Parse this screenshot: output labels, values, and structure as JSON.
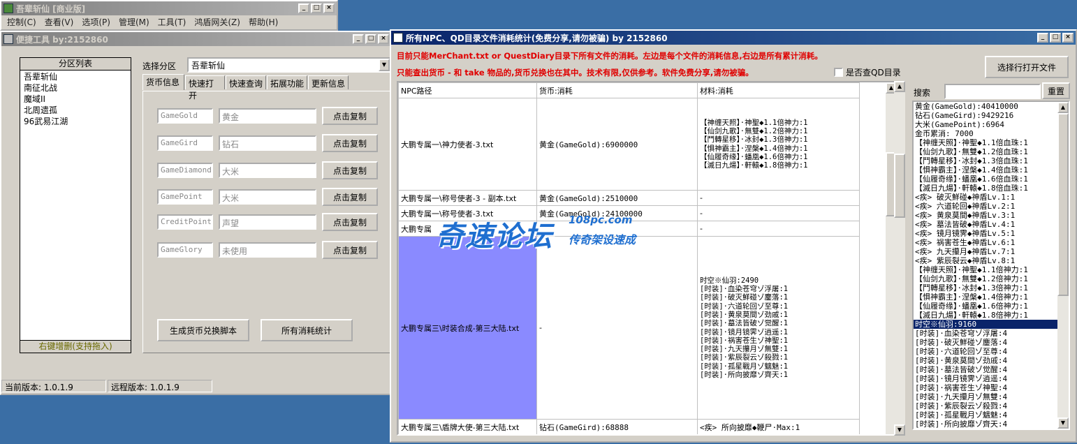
{
  "main_window": {
    "title": "吾辈斩仙 [商业版]",
    "menus": [
      "控制(C)",
      "查看(V)",
      "选项(P)",
      "管理(M)",
      "工具(T)",
      "鸿盾网关(Z)",
      "帮助(H)"
    ]
  },
  "tool_window": {
    "title": "便捷工具   by:2152860",
    "zone_list_title": "分区列表",
    "zones": [
      "吾辈斩仙",
      "南征北战",
      "魔域II",
      "北周遗孤",
      "96武易江湖"
    ],
    "zone_hint": "右键增删(支持拖入)",
    "select_label": "选择分区",
    "select_value": "吾辈斩仙",
    "tabs": [
      "货币信息",
      "快速打开",
      "快速查询",
      "拓展功能",
      "更新信息"
    ],
    "currency_rows": [
      {
        "key": "GameGold",
        "name": "黄金",
        "button": "点击复制"
      },
      {
        "key": "GameGird",
        "name": "钻石",
        "button": "点击复制"
      },
      {
        "key": "GameDiamond",
        "name": "大米",
        "button": "点击复制"
      },
      {
        "key": "GamePoint",
        "name": "大米",
        "button": "点击复制"
      },
      {
        "key": "CreditPoint",
        "name": "声望",
        "button": "点击复制"
      },
      {
        "key": "GameGlory",
        "name": "未使用",
        "button": "点击复制"
      }
    ],
    "generate_button": "生成货币兑换脚本",
    "all_stats_button": "所有消耗统计",
    "status_local": "当前版本: 1.0.1.9",
    "status_remote": "远程版本: 1.0.1.9"
  },
  "stats_window": {
    "title": "所有NPC、QD目录文件消耗统计(免费分享,请勿被骗)     by 2152860",
    "notice1": "目前只能MerChant.txt or QuestDiary目录下所有文件的消耗。左边是每个文件的消耗信息,右边是所有累计消耗。",
    "notice2": "只能查出货币 - 和 take 物品的,货币兑换也在其中。技术有限,仅供参考。软件免费分享,请勿被骗。",
    "checkbox_label": "是否查QD目录",
    "open_button": "选择行打开文件",
    "search_label": "搜索",
    "reset_button": "重置",
    "columns": [
      "NPC路径",
      "货币:消耗",
      "材料:消耗"
    ],
    "rows": [
      {
        "path": "大鹏专属一\\神力使者-3.txt",
        "currency": "黄金(GameGold):6900000",
        "materials": "【神缠天照】·神聖◆1.1倍神力:1\n【仙剑九歌】·無雙◆1.2倍神力:1\n【鬥轉星移】·冰封◆1.3倍神力:1\n【惧神霸主】·涅槃◆1.4倍神力:1\n【仙履奇缘】·蟠凰◆1.6倍神力:1\n【滅日九煬】·軒轅◆1.8倍神力:1"
      },
      {
        "path": "大鹏专属一\\称号使者-3 - 副本.txt",
        "currency": "黄金(GameGold):2510000",
        "materials": "-"
      },
      {
        "path": "大鹏专属一\\称号使者-3.txt",
        "currency": "黄金(GameGold):24100000",
        "materials": "-"
      },
      {
        "path": "大鹏专属",
        "currency": "",
        "materials": "-"
      },
      {
        "path": "大鹏专属三\\时装合成-第三大陆.txt",
        "currency": "-",
        "materials": "时空※仙羽:2490\n[时装]·血染苍穹ゾ浮屠:1\n[时装]·破灭鮮碰ゾ鏖落:1\n[时装]·六道轮回ゾ至尊:1\n[时装]·黄泉莫間ゾ劲戚:1\n[时装]·墓法皆破ゾ觉醒:1\n[时装]·镜月镜霁ゾ逍遥:1\n[时装]·祸害苍生ゾ神聖:1\n[时装]·九天攥月ゾ無雙:1\n[时装]·紫辰裂云ゾ殺戮:1\n[时装]·孤星戰月ゾ魑魅:1\n[时装]·所向披靡ゾ齊天:1"
      },
      {
        "path": "大鹏专属三\\盾牌大使-第三大陆.txt",
        "currency": "钻石(GameGird):68888",
        "materials": "<疾> 所向披靡◆鞭尸·Max:1"
      }
    ],
    "watermark_main": "奇速论坛",
    "watermark_url": "108pc.com",
    "watermark_sub": "传奇架设速成",
    "summary": [
      "黄金(GameGold):40410000",
      "钻石(GameGird):9429216",
      "大米(GamePoint):6964",
      "金币累消: 7000",
      "【神缠天照】·神聖◆1.1倍血珠:1",
      "【仙剑九歌】·無雙◆1.2倍血珠:1",
      "【鬥轉星移】·冰封◆1.3倍血珠:1",
      "【惧神霸主】·涅槃◆1.4倍血珠:1",
      "【仙履奇缘】·蟠凰◆1.6倍血珠:1",
      "【滅日九煬】·軒轅◆1.8倍血珠:1",
      "<疾> 破灭鮮碰◆神盾Lv.1:1",
      "<疾> 六道轮回◆神盾Lv.2:1",
      "<疾> 黄泉莫間◆神盾Lv.3:1",
      "<疾> 墓法皆破◆神盾Lv.4:1",
      "<疾> 镜月镜霁◆神盾Lv.5:1",
      "<疾> 祸害苍生◆神盾Lv.6:1",
      "<疾> 九天攥月◆神盾Lv.7:1",
      "<疾> 紫辰裂云◆神盾Lv.8:1",
      "【神缠天照】·神聖◆1.1倍神力:1",
      "【仙剑九歌】·無雙◆1.2倍神力:1",
      "【鬥轉星移】·冰封◆1.3倍神力:1",
      "【惧神霸主】·涅槃◆1.4倍神力:1",
      "【仙履奇缘】·蟠凰◆1.6倍神力:1",
      "【滅日九煬】·軒轅◆1.8倍神力:1",
      "时空※仙羽:9160",
      "[时装]·血染苍穹ゾ浮屠:4",
      "[时装]·破灭鮮碰ゾ鏖落:4",
      "[时装]·六道轮回ゾ至尊:4",
      "[时装]·黄泉莫間ゾ劲戚:4",
      "[时装]·墓法皆破ゾ觉醒:4",
      "[时装]·镜月镜霁ゾ逍遥:4",
      "[时装]·祸害苍生ゾ神聖:4",
      "[时装]·九天攥月ゾ無雙:4",
      "[时装]·紫辰裂云ゾ殺戮:4",
      "[时装]·孤星戰月ゾ魑魅:4",
      "[时装]·所向披靡ゾ齊天:4"
    ],
    "selected_summary_index": 24
  }
}
